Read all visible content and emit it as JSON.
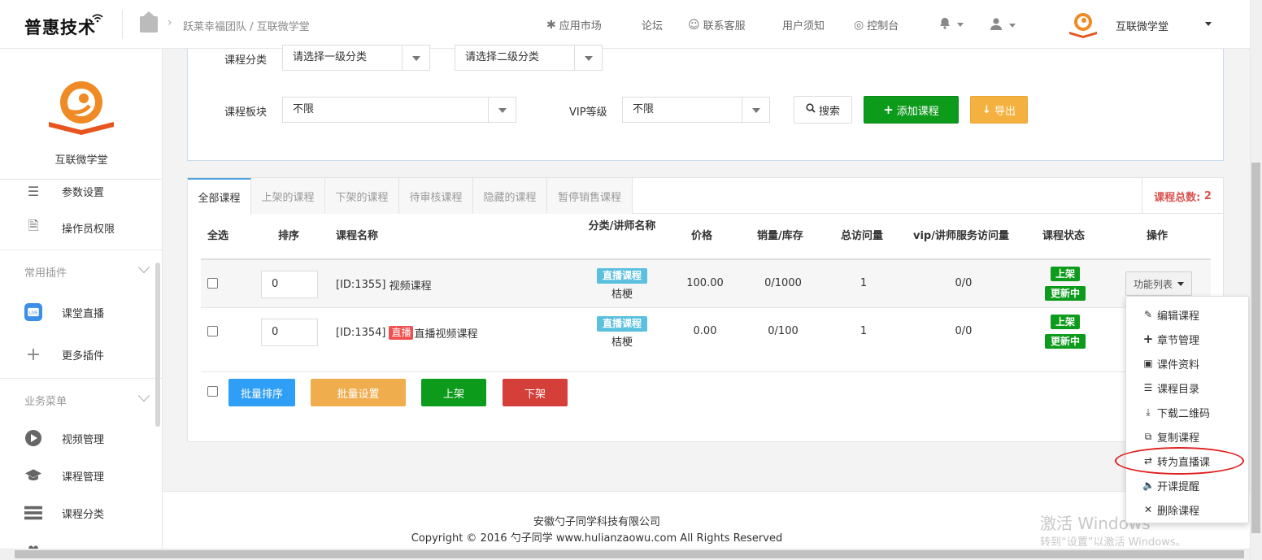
{
  "header": {
    "logo_text": "普惠技术",
    "breadcrumb": "跃莱幸福团队 / 互联微学堂",
    "nav": [
      "应用市场",
      "论坛",
      "联系客服",
      "用户须知",
      "控制台"
    ],
    "user_name": "互联微学堂"
  },
  "sidebar": {
    "title": "互联微学堂",
    "items_top": [
      "参数设置",
      "操作员权限"
    ],
    "group_plugins": "常用插件",
    "plugins": [
      "课堂直播",
      "更多插件"
    ],
    "group_business": "业务菜单",
    "business": [
      "视频管理",
      "课程管理",
      "课程分类"
    ]
  },
  "filters": {
    "category_label": "课程分类",
    "category1": "请选择一级分类",
    "category2": "请选择二级分类",
    "section_label": "课程板块",
    "section_value": "不限",
    "vip_label": "VIP等级",
    "vip_value": "不限",
    "search_button": "搜索",
    "add_button": "添加课程",
    "export_button": "导出"
  },
  "tabs": [
    "全部课程",
    "上架的课程",
    "下架的课程",
    "待审核课程",
    "隐藏的课程",
    "暂停销售课程"
  ],
  "total": {
    "label": "课程总数:",
    "value": "2"
  },
  "table": {
    "headers": [
      "全选",
      "排序",
      "课程名称",
      "分类/讲师名称",
      "价格",
      "销量/库存",
      "总访问量",
      "vip/讲师服务访问量",
      "课程状态",
      "操作"
    ],
    "rows": [
      {
        "sort": "0",
        "id": "[ID:1355]",
        "live_tag": "",
        "name": "视频课程",
        "category": "直播课程",
        "teacher": "桔梗",
        "price": "100.00",
        "sales": "0/1000",
        "visits": "1",
        "vip_visits": "0/0",
        "status1": "上架",
        "status2": "更新中"
      },
      {
        "sort": "0",
        "id": "[ID:1354]",
        "live_tag": "直播",
        "name": "直播视频课程",
        "category": "直播课程",
        "teacher": "桔梗",
        "price": "0.00",
        "sales": "0/100",
        "visits": "1",
        "vip_visits": "0/0",
        "status1": "上架",
        "status2": "更新中"
      }
    ],
    "function_button": "功能列表"
  },
  "batch": {
    "sort": "批量排序",
    "settings": "批量设置",
    "on": "上架",
    "off": "下架",
    "colors": {
      "sort": "#2e9ef6",
      "settings": "#f0ad4e",
      "on": "#0c9b1b",
      "off": "#d43f3a"
    }
  },
  "menu": {
    "items": [
      {
        "icon": "edit-icon",
        "label": "编辑课程"
      },
      {
        "icon": "plus-icon",
        "label": "章节管理"
      },
      {
        "icon": "word-file-icon",
        "label": "课件资料"
      },
      {
        "icon": "list-icon",
        "label": "课程目录"
      },
      {
        "icon": "download-icon",
        "label": "下载二维码"
      },
      {
        "icon": "copy-icon",
        "label": "复制课程"
      },
      {
        "icon": "exchange-icon",
        "label": "转为直播课"
      },
      {
        "icon": "volume-icon",
        "label": "开课提醒"
      },
      {
        "icon": "close-icon",
        "label": "删除课程"
      }
    ]
  },
  "footer": {
    "company": "安徽勺子同学科技有限公司",
    "copyright": "Copyright © 2016 勺子同学 www.hulianzaowu.com All Rights Reserved"
  },
  "watermark": {
    "line1": "激活 Windows",
    "line2": "转到“设置”以激活 Windows。"
  },
  "colors": {
    "accent_blue": "#4aa3df",
    "green": "#0c9b1b",
    "red": "#d9534f",
    "orange": "#f5b13f"
  }
}
